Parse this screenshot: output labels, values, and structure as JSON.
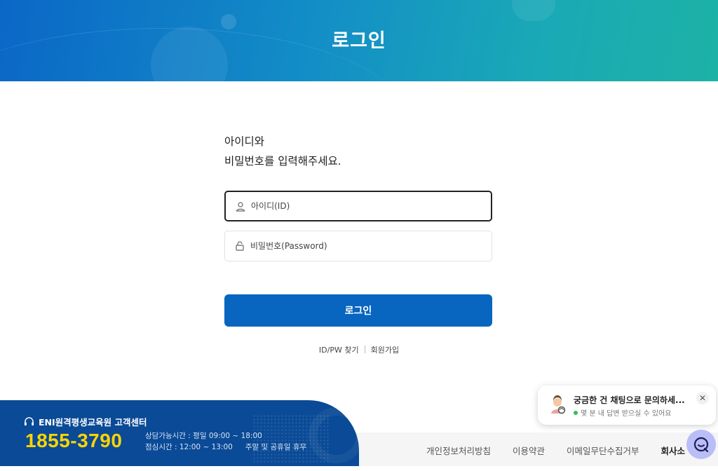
{
  "header": {
    "title": "로그인"
  },
  "intro": {
    "line1": "아이디와",
    "line2": "비밀번호를 입력해주세요."
  },
  "form": {
    "id_placeholder": "아이디(ID)",
    "pw_placeholder": "비밀번호(Password)",
    "submit_label": "로그인"
  },
  "links": {
    "find": "ID/PW 찾기",
    "signup": "회원가입"
  },
  "customer_center": {
    "title": "ENI원격평생교육원 고객센터",
    "phone": "1855-3790",
    "hours_line1": "상담가능시간 : 평일 09:00 ~ 18:00",
    "hours_line2a": "점심시간 : 12:00 ~ 13:00",
    "hours_line2b": "주말 및 공휴일 휴무"
  },
  "footer": {
    "links": [
      "개인정보처리방침",
      "이용약관",
      "이메일무단수집거부",
      "회사소"
    ]
  },
  "chat": {
    "message": "궁금한 건 채팅으로 문의하세...",
    "status": "몇 분 내 답변 받으실 수 있어요",
    "close": "✕"
  },
  "icons": {
    "user": "user-icon",
    "lock": "lock-icon",
    "headset": "headset-icon",
    "chat": "chat-icon"
  },
  "colors": {
    "primary": "#0865c0",
    "phone": "#ffd400",
    "cs_bg": "#0a4a96"
  }
}
